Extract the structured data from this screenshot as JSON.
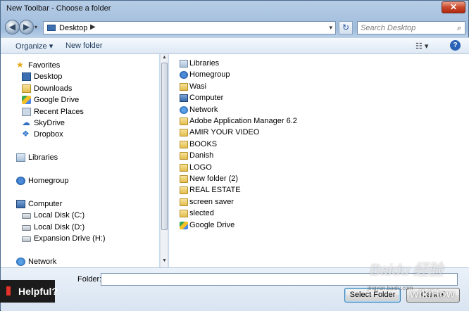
{
  "window": {
    "title": "New Toolbar - Choose a folder",
    "close_label": "✕"
  },
  "address_bar": {
    "back_label": "◀",
    "forward_label": "▶",
    "location": "Desktop",
    "separator": "▶",
    "refresh_label": "↻"
  },
  "search": {
    "placeholder": "Search Desktop",
    "icon": "search-icon"
  },
  "toolbar": {
    "organize_label": "Organize ▾",
    "new_folder_label": "New folder",
    "views_label": "☷ ▾",
    "help_label": "?"
  },
  "nav": {
    "favorites_header": "Favorites",
    "favorites": [
      "Desktop",
      "Downloads",
      "Google Drive",
      "Recent Places",
      "SkyDrive",
      "Dropbox"
    ],
    "libraries": "Libraries",
    "homegroup": "Homegroup",
    "computer_header": "Computer",
    "drives": [
      "Local Disk (C:)",
      "Local Disk (D:)",
      "Expansion Drive (H:)"
    ],
    "network": "Network"
  },
  "files": [
    "Libraries",
    "Homegroup",
    "Wasi",
    "Computer",
    "Network",
    "Adobe Application Manager 6.2",
    "AMIR YOUR VIDEO",
    "BOOKS",
    "Danish",
    "LOGO",
    "New folder (2)",
    "REAL ESTATE",
    "screen saver",
    "slected",
    "Google Drive"
  ],
  "bottom": {
    "folder_label": "Folder:",
    "folder_value": "",
    "select_label": "Select Folder",
    "cancel_label": "Cancel"
  },
  "overlay": {
    "helpful_label": "Helpful?",
    "baidu_watermark": "Baidu 经验",
    "wiki_watermark": "wikiHow",
    "watermark_url": "jingyan.baidu.com"
  }
}
